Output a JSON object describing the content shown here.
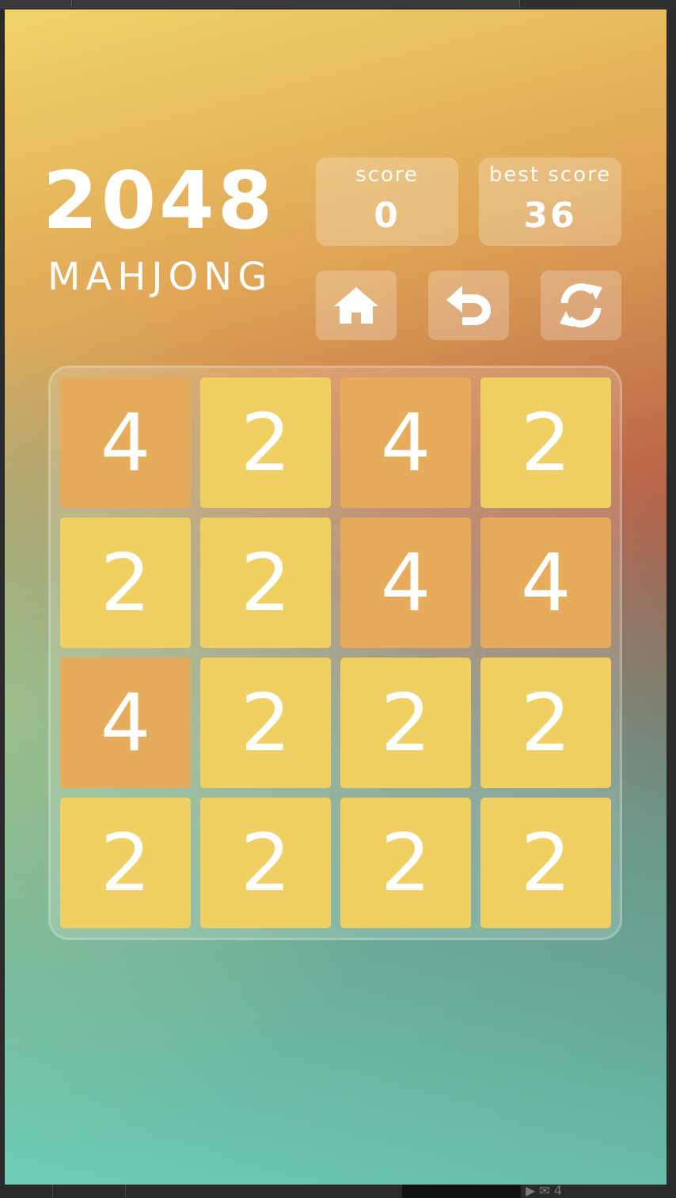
{
  "header": {
    "title": "2048",
    "subtitle": "MAHJONG"
  },
  "scores": {
    "score_label": "score",
    "score_value": "0",
    "best_label": "best score",
    "best_value": "36"
  },
  "toolbar": {
    "home_icon": "home-icon",
    "undo_icon": "undo-icon",
    "restart_icon": "restart-icon"
  },
  "colors": {
    "tile_2": "#f0d062",
    "tile_4": "#e6ab5b"
  },
  "board": {
    "rows": [
      [
        "4",
        "2",
        "4",
        "2"
      ],
      [
        "2",
        "2",
        "4",
        "4"
      ],
      [
        "4",
        "2",
        "2",
        "2"
      ],
      [
        "2",
        "2",
        "2",
        "2"
      ]
    ]
  },
  "status_bar": {
    "count": "4"
  }
}
